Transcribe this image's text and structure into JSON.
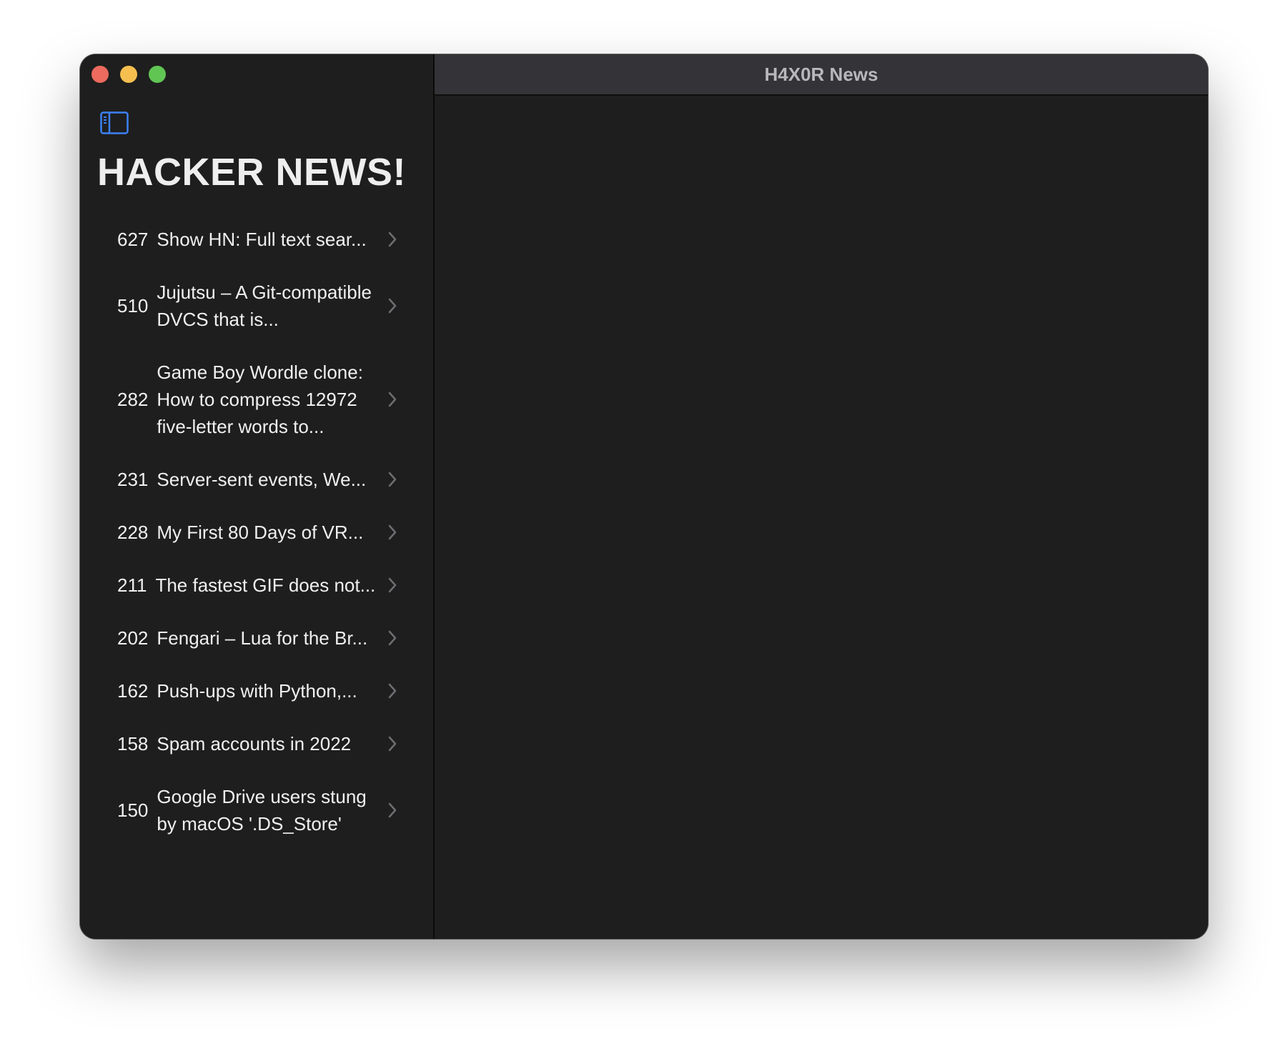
{
  "window": {
    "title": "H4X0R News"
  },
  "sidebar": {
    "title": "HACKER NEWS!",
    "toggle_icon": "sidebar-toggle-icon",
    "accent": "#3b82f6"
  },
  "stories": [
    {
      "points": "627",
      "title": "Show HN: Full text sear..."
    },
    {
      "points": "510",
      "title": "Jujutsu – A Git-compatible DVCS that is..."
    },
    {
      "points": "282",
      "title": "Game Boy Wordle clone: How to compress 12972 five-letter words to..."
    },
    {
      "points": "231",
      "title": "Server-sent events, We..."
    },
    {
      "points": "228",
      "title": "My First 80 Days of VR..."
    },
    {
      "points": "211",
      "title": "The fastest GIF does not..."
    },
    {
      "points": "202",
      "title": "Fengari – Lua for the Br..."
    },
    {
      "points": "162",
      "title": "Push-ups with Python,..."
    },
    {
      "points": "158",
      "title": "Spam accounts in 2022"
    },
    {
      "points": "150",
      "title": "Google Drive users stung by macOS '.DS_Store'"
    }
  ]
}
